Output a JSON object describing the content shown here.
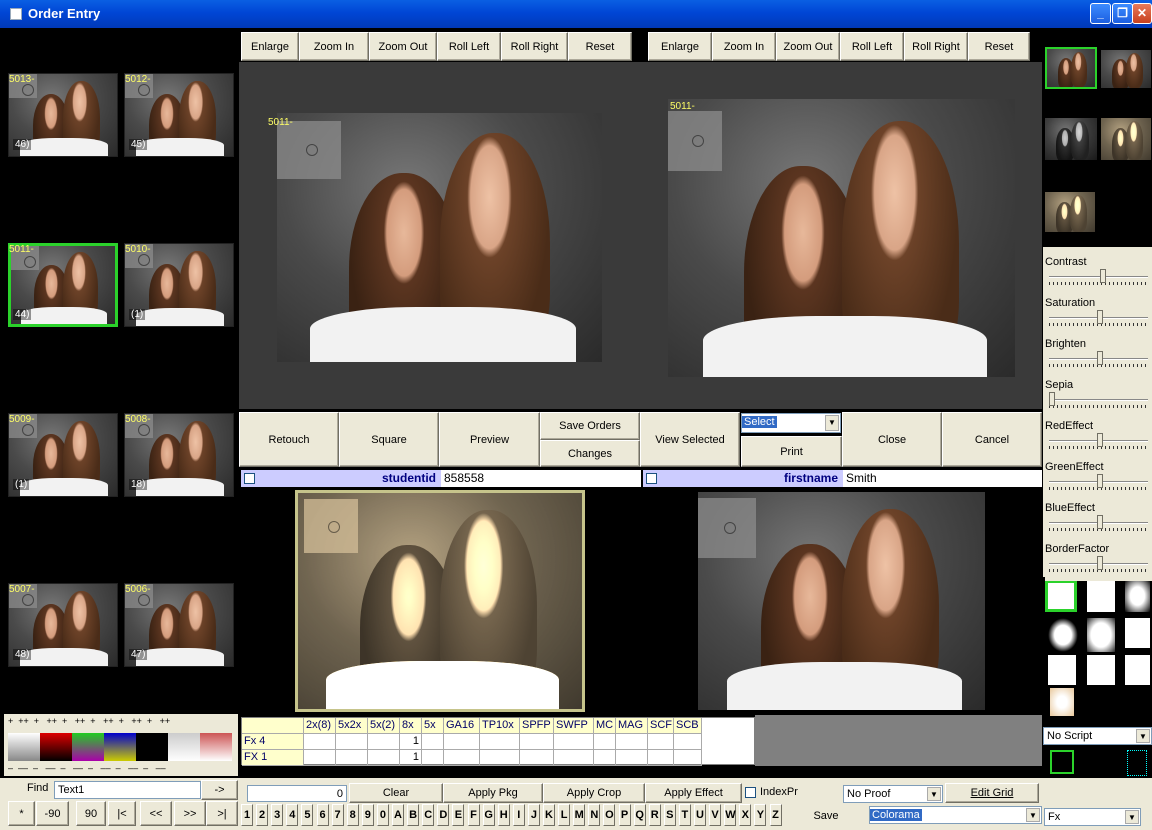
{
  "window": {
    "title": "Order Entry"
  },
  "toolbar_left": [
    "Enlarge",
    "Zoom In",
    "Zoom Out",
    "Roll Left",
    "Roll Right",
    "Reset"
  ],
  "toolbar_right": [
    "Enlarge",
    "Zoom In",
    "Zoom Out",
    "Roll Left",
    "Roll Right",
    "Reset"
  ],
  "thumbnails": [
    {
      "id": "5013-",
      "count": "46)"
    },
    {
      "id": "5012-",
      "count": "45)"
    },
    {
      "id": "5011-",
      "count": "44)"
    },
    {
      "id": "5010-",
      "count": "(1)"
    },
    {
      "id": "5009-",
      "count": "(1)"
    },
    {
      "id": "5008-",
      "count": "18)"
    },
    {
      "id": "5007-",
      "count": "48)"
    },
    {
      "id": "5006-",
      "count": "47)"
    }
  ],
  "preview": {
    "left_label": "5011-",
    "right_label": "5011-"
  },
  "actions": {
    "retouch": "Retouch",
    "square": "Square",
    "preview": "Preview",
    "save_orders": "Save Orders",
    "changes": "Changes",
    "view_selected": "View Selected",
    "select_value": "Select",
    "print": "Print",
    "close": "Close",
    "cancel": "Cancel"
  },
  "fields": {
    "studentid_label": "studentid",
    "studentid_value": "858558",
    "firstname_label": "firstname",
    "firstname_value": "Smith"
  },
  "sliders": [
    "Contrast",
    "Saturation",
    "Brighten",
    "Sepia",
    "RedEffect",
    "GreenEffect",
    "BlueEffect",
    "BorderFactor"
  ],
  "palette": {
    "top_marks": "+  ++  +   ++  +   ++  +   ++  +   ++  +   ++",
    "bottom_marks": "–  ––  –   ––  –   ––  –   ––  –   ––  –   ––"
  },
  "grid": {
    "headers": [
      "2x(8)",
      "5x2x",
      "5x(2)",
      "8x",
      "5x",
      "GA16",
      "TP10x",
      "SPFP",
      "SWFP",
      "MC",
      "MAG",
      "SCF",
      "SCB"
    ],
    "rows": [
      {
        "label": "Fx 4",
        "value": "1"
      },
      {
        "label": "FX 1",
        "value": "1"
      }
    ]
  },
  "script_combo": "No Script",
  "bottom": {
    "find_label": "Find",
    "find_value": "Text1",
    "go": "->",
    "qty_value": "0",
    "clear": "Clear",
    "apply_pkg": "Apply Pkg",
    "apply_crop": "Apply Crop",
    "apply_effect": "Apply Effect",
    "indexpr": "IndexPr",
    "proof_value": "No Proof",
    "edit_grid": "Edit Grid",
    "save": "Save",
    "colorama_value": "Colorama",
    "fx_value": "Fx",
    "nav": [
      "*",
      "-90",
      "90",
      "|<",
      "<<",
      ">>",
      ">|"
    ],
    "keys": [
      "1",
      "2",
      "3",
      "4",
      "5",
      "6",
      "7",
      "8",
      "9",
      "0",
      "A",
      "B",
      "C",
      "D",
      "E",
      "F",
      "G",
      "H",
      "I",
      "J",
      "K",
      "L",
      "M",
      "N",
      "O",
      "P",
      "Q",
      "R",
      "S",
      "T",
      "U",
      "V",
      "W",
      "X",
      "Y",
      "Z"
    ]
  },
  "colors": {
    "selection": "#2bd22b",
    "label_yellow": "#ffff66",
    "field_label_bg": "#ccccff",
    "grid_header": "#ffffcc"
  }
}
